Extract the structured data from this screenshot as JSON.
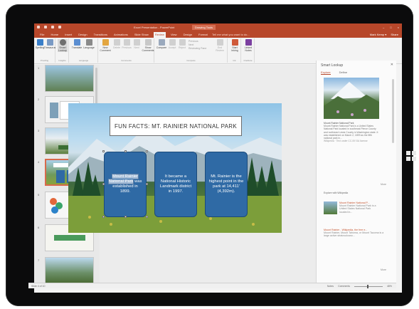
{
  "window": {
    "title": "Excel Presentation - PowerPoint",
    "context_tab": "Drawing Tools",
    "controls": [
      "–",
      "□",
      "×"
    ]
  },
  "ribbon_tabs": [
    "File",
    "Home",
    "Insert",
    "Design",
    "Transitions",
    "Animations",
    "Slide Show",
    "Review",
    "View",
    "Design",
    "Format"
  ],
  "active_tab_index": 7,
  "tell_me": "Tell me what you want to do...",
  "account": {
    "user": "Mark Kemp ▾",
    "share": "Share"
  },
  "ribbon": {
    "proofing": {
      "spelling": "Spelling",
      "thesaurus": "Thesaurus",
      "label": "Proofing"
    },
    "insights": {
      "smart_lookup": "Smart Lookup",
      "label": "Insights"
    },
    "language": {
      "translate": "Translate",
      "language": "Language",
      "label": "Language"
    },
    "comments": {
      "new_comment": "New Comment",
      "delete": "Delete",
      "previous": "Previous",
      "next": "Next",
      "show_comments": "Show Comments",
      "label": "Comments"
    },
    "compare": {
      "compare": "Compare",
      "accept": "Accept",
      "reject": "Reject",
      "rows": [
        "Previous",
        "Next",
        "Reviewing Pane"
      ],
      "end_review": "End Review",
      "label": "Compare"
    },
    "ink": {
      "start_inking": "Start Inking",
      "label": "Ink"
    },
    "onenote": {
      "linked_notes": "Linked Notes",
      "label": "OneNote"
    }
  },
  "slides": {
    "numbers": [
      "1",
      "2",
      "3",
      "4",
      "5",
      "6",
      "7"
    ],
    "selected_index": 3
  },
  "slide": {
    "title": "FUN FACTS: MT. RAINIER NATIONAL PARK",
    "card1_highlight": "Mount Rainier National Park",
    "card1_rest": "was established in 1899.",
    "card2": "It became a National Historic Landmark district in 1997.",
    "card3": "Mt. Rainier is the highest point in the park at 14,411' (4,392m)."
  },
  "smart_lookup": {
    "title": "Smart Lookup",
    "tabs": [
      "Explore",
      "Define"
    ],
    "active_tab": 0,
    "caption_title": "Mount Rainier National Park",
    "caption_body": "Mount Rainier National Park is a United States National Park located in southeast Pierce County and northeast Lewis County in Washington state. It was established on March 2, 1899 as the fifth national park in...",
    "source": "Wikipedia · Text under CC-BY-SA license",
    "more": "More",
    "explore_header": "Explore with Wikipedia",
    "results": [
      {
        "title": "Mount Rainier National P...",
        "body": "Mount Rainier National Park is a United States National Park located in..."
      },
      {
        "title": "Mount Rainier - Wikipedia, the free e...",
        "body": "Mount Rainier, Mount Tahoma, or Mount Tacoma is a large active stratovolcano..."
      }
    ],
    "more2": "More"
  },
  "status": {
    "left": "Slide 4 of 10",
    "right": [
      "Notes",
      "Comments",
      "48%"
    ]
  }
}
